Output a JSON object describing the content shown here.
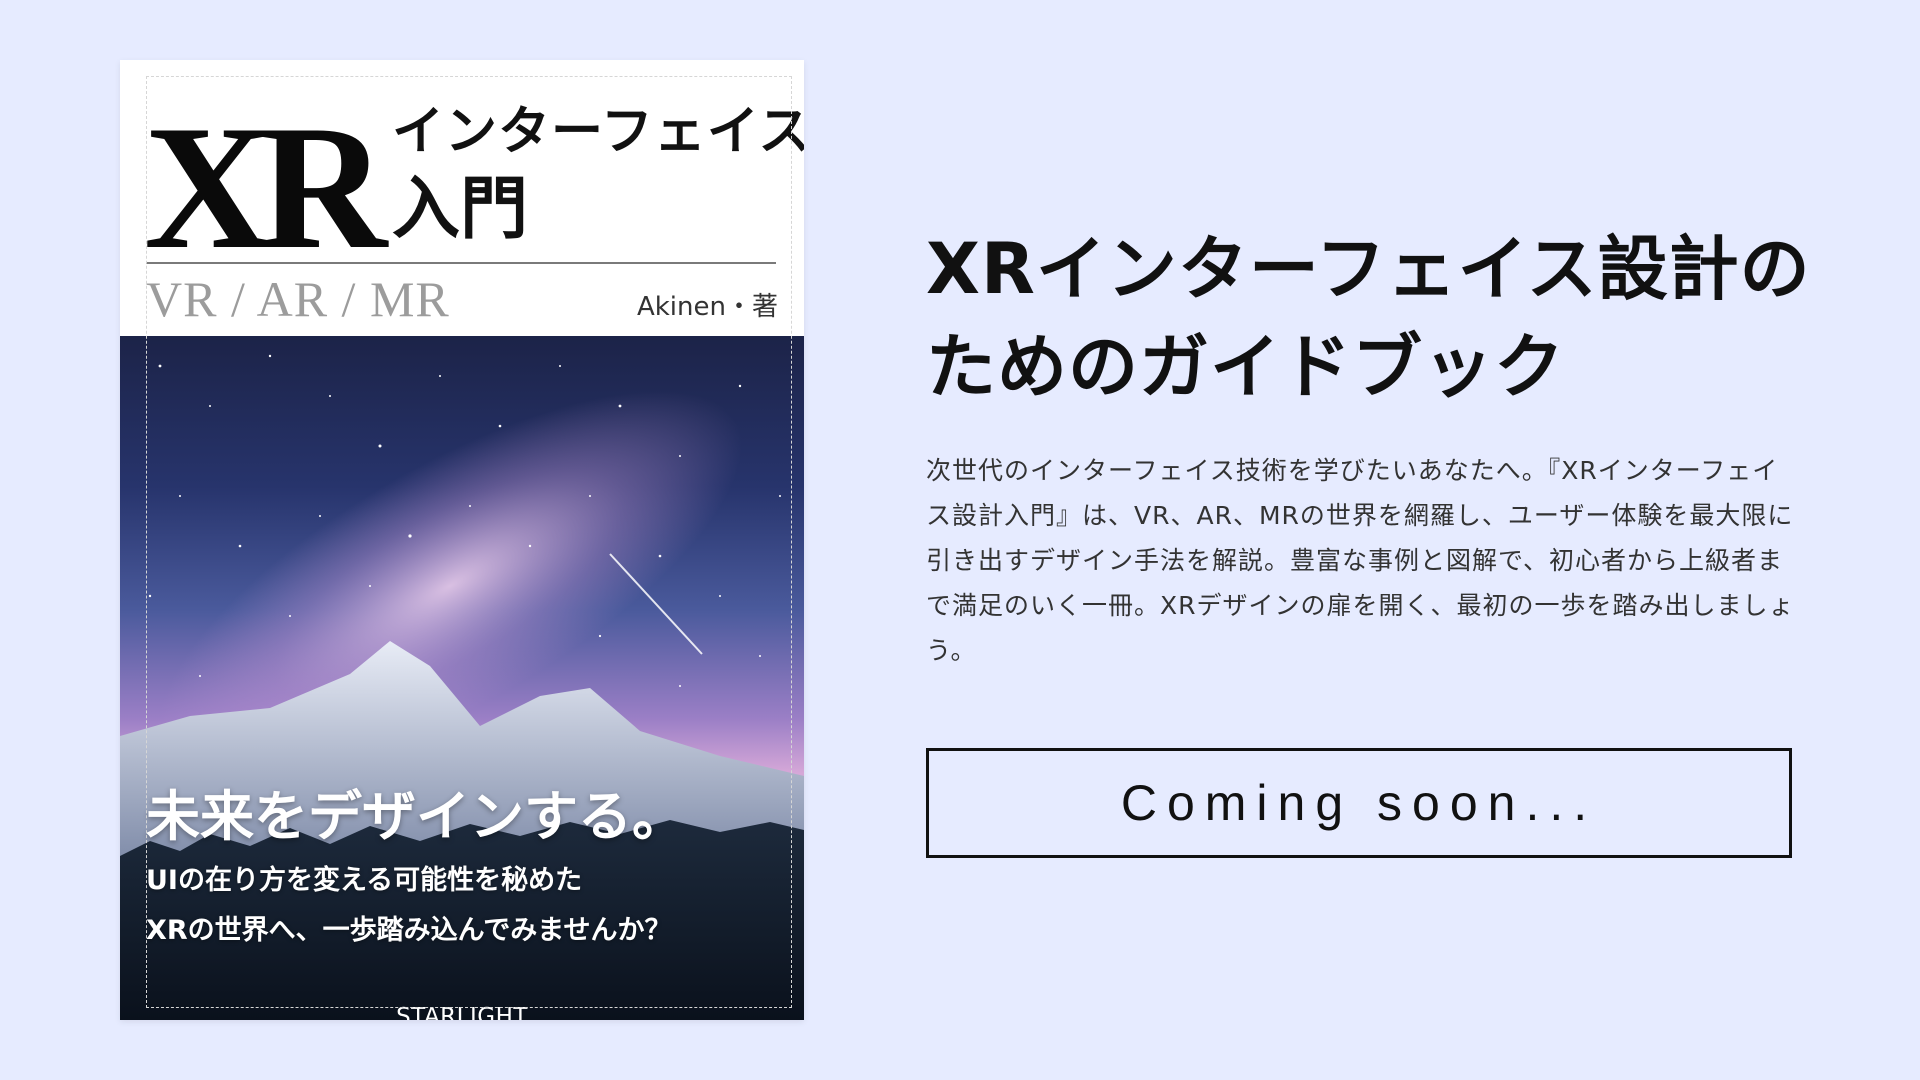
{
  "cover": {
    "logo": "XR",
    "title_line1": "インターフェイス",
    "title_line2": "入門",
    "subtitle": "VR / AR / MR",
    "author": "Akinen・著",
    "tagline": "未来をデザインする。",
    "sub_tagline_line1": "UIの在り方を変える可能性を秘めた",
    "sub_tagline_line2": "XRの世界へ、一歩踏み込んでみませんか？",
    "publisher": "STARLIGHT"
  },
  "main": {
    "headline_line1": "XRインターフェイス設計の",
    "headline_line2": "ためのガイドブック",
    "description": "次世代のインターフェイス技術を学びたいあなたへ。『XRインターフェイス設計入門』は、VR、AR、MRの世界を網羅し、ユーザー体験を最大限に引き出すデザイン手法を解説。豊富な事例と図解で、初心者から上級者まで満足のいく一冊。XRデザインの扉を開く、最初の一歩を踏み出しましょう。",
    "cta_label": "Coming soon..."
  },
  "colors": {
    "page_background": "#e6ebff",
    "text": "#111111",
    "subtitle_gray": "#9c9c9c"
  }
}
